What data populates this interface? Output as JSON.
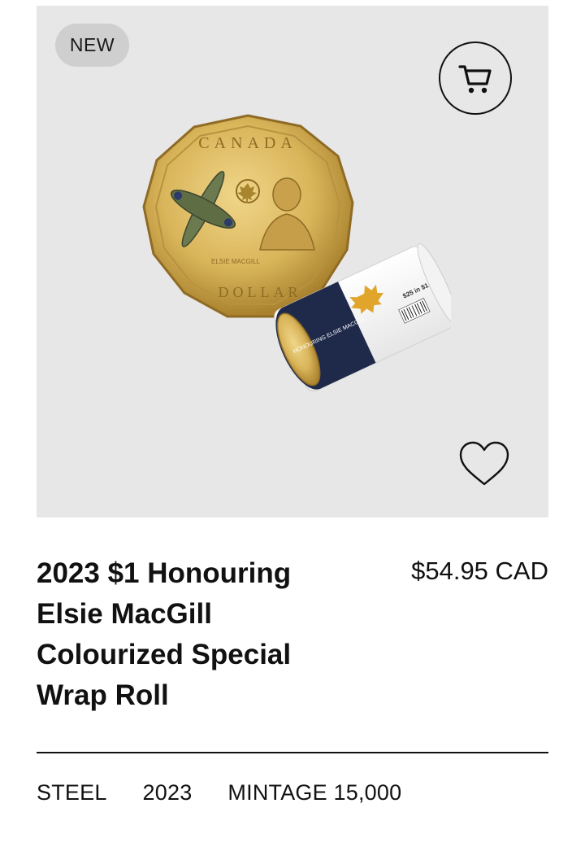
{
  "product": {
    "badge": "NEW",
    "title": "2023 $1 Honouring Elsie MacGill Colourized Special Wrap Roll",
    "price": "$54.95 CAD",
    "image_icon": "coin-and-roll-image",
    "coin_text": {
      "top": "CANADA",
      "bottom": "DOLLAR",
      "name": "ELSIE MACGILL"
    },
    "roll_text": {
      "side": "HONOURING ELSIE MACGILL",
      "value": "$25 in $1"
    },
    "actions": {
      "cart_icon": "cart-icon",
      "wishlist_icon": "heart-icon"
    },
    "specs": {
      "metal": "STEEL",
      "year": "2023",
      "mintage": "MINTAGE 15,000"
    }
  },
  "colors": {
    "image_bg": "#e7e7e7",
    "badge_bg": "#cfcfcf",
    "text": "#111111",
    "coin_gold": "#d9b55a",
    "roll_navy": "#1f2a4a"
  }
}
